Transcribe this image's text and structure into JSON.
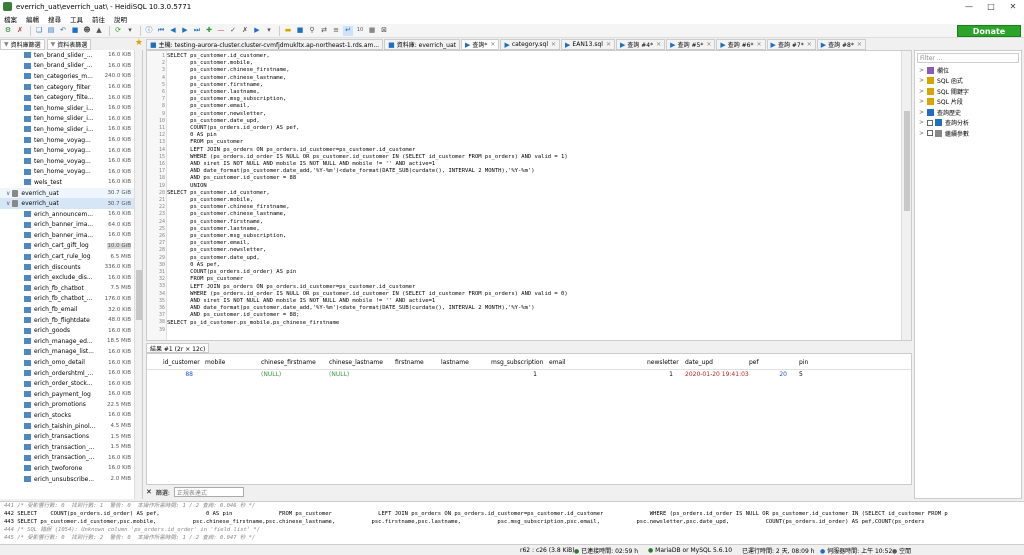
{
  "window": {
    "title": "everrich_uat\\everrich_uat\\ - HeidiSQL 10.3.0.5771"
  },
  "menu": [
    "檔案",
    "編輯",
    "搜尋",
    "工具",
    "前往",
    "說明"
  ],
  "donate_label": "Donate",
  "left_tabs": [
    "資料庫篩選",
    "資料表篩選"
  ],
  "tree": {
    "group1": [
      {
        "name": "ten_brand_slider_...",
        "size": "16.0 KiB"
      },
      {
        "name": "ten_brand_slider_...",
        "size": "16.0 KiB"
      },
      {
        "name": "ten_categories_m...",
        "size": "240.0 KiB"
      },
      {
        "name": "ten_category_filter",
        "size": "16.0 KiB"
      },
      {
        "name": "ten_category_filte...",
        "size": "16.0 KiB"
      },
      {
        "name": "ten_home_slider_i...",
        "size": "16.0 KiB"
      },
      {
        "name": "ten_home_slider_i...",
        "size": "16.0 KiB"
      },
      {
        "name": "ten_home_slider_i...",
        "size": "16.0 KiB"
      },
      {
        "name": "ten_home_voyag...",
        "size": "16.0 KiB"
      },
      {
        "name": "ten_home_voyag...",
        "size": "16.0 KiB"
      },
      {
        "name": "ten_home_voyag...",
        "size": "16.0 KiB"
      },
      {
        "name": "ten_home_voyag...",
        "size": "16.0 KiB"
      },
      {
        "name": "wels_test",
        "size": "16.0 KiB"
      }
    ],
    "db1": {
      "name": "everrich_uat",
      "size": "30.7 GiB"
    },
    "db2": {
      "name": "everrich_uat",
      "size": "30.7 GiB"
    },
    "group2": [
      {
        "name": "erich_announcem...",
        "size": "16.0 KiB"
      },
      {
        "name": "erich_banner_ima...",
        "size": "64.0 KiB"
      },
      {
        "name": "erich_banner_ima...",
        "size": "16.0 KiB"
      },
      {
        "name": "erich_cart_gift_log",
        "size": "10.0 GiB"
      },
      {
        "name": "erich_cart_rule_log",
        "size": "6.5 MiB"
      },
      {
        "name": "erich_discounts",
        "size": "336.0 KiB"
      },
      {
        "name": "erich_exclude_dis...",
        "size": "16.0 KiB"
      },
      {
        "name": "erich_fb_chatbot",
        "size": "7.5 MiB"
      },
      {
        "name": "erich_fb_chatbot_...",
        "size": "176.0 KiB"
      },
      {
        "name": "erich_fb_email",
        "size": "32.0 KiB"
      },
      {
        "name": "erich_fb_flightdate",
        "size": "48.0 KiB"
      },
      {
        "name": "erich_goods",
        "size": "16.0 KiB"
      },
      {
        "name": "erich_manage_ed...",
        "size": "18.5 MiB"
      },
      {
        "name": "erich_manage_list...",
        "size": "16.0 KiB"
      },
      {
        "name": "erich_omo_detail",
        "size": "16.0 KiB"
      },
      {
        "name": "erich_ordershtml_...",
        "size": "16.0 KiB"
      },
      {
        "name": "erich_order_stock...",
        "size": "16.0 KiB"
      },
      {
        "name": "erich_payment_log",
        "size": "16.0 KiB"
      },
      {
        "name": "erich_promotions",
        "size": "22.5 MiB"
      },
      {
        "name": "erich_stocks",
        "size": "16.0 KiB"
      },
      {
        "name": "erich_taishin_pinol...",
        "size": "4.5 MiB"
      },
      {
        "name": "erich_transactions",
        "size": "1.5 MiB"
      },
      {
        "name": "erich_transaction_...",
        "size": "1.5 MiB"
      },
      {
        "name": "erich_transaction_...",
        "size": "16.0 KiB"
      },
      {
        "name": "erich_twoforone",
        "size": "16.0 KiB"
      },
      {
        "name": "erich_unsubscribe...",
        "size": "2.0 MiB"
      }
    ]
  },
  "query_tabs": [
    {
      "label": "主機: testing-aurora-cluster.cluster-cvmfjdmukltx.ap-northeast-1.rds.am...",
      "active": false
    },
    {
      "label": "資料庫: everrich_uat",
      "active": false
    },
    {
      "label": "查詢*",
      "active": true
    },
    {
      "label": "category.sql",
      "active": false
    },
    {
      "label": "EAN13.sql",
      "active": false
    },
    {
      "label": "查詢 #4*",
      "active": false
    },
    {
      "label": "查詢 #5*",
      "active": false
    },
    {
      "label": "查詢 #6*",
      "active": false
    },
    {
      "label": "查詢 #7*",
      "active": false
    },
    {
      "label": "查詢 #8*",
      "active": false
    }
  ],
  "code_lines": [
    "SELECT ps_customer.id_customer,",
    "       ps_customer.mobile,",
    "       ps_customer.chinese_firstname,",
    "       ps_customer.chinese_lastname,",
    "       ps_customer.firstname,",
    "       ps_customer.lastname,",
    "       ps_customer.msg_subscription,",
    "       ps_customer.email,",
    "       ps_customer.newsletter,",
    "       ps_customer.date_upd,",
    "       COUNT(ps_orders.id_order) AS pef,",
    "       0 AS pin",
    "       FROM ps_customer",
    "       LEFT JOIN ps_orders ON ps_orders.id_customer=ps_customer.id_customer",
    "       WHERE (ps_orders.id_order IS NULL OR ps_customer.id_customer IN (SELECT id_customer FROM ps_orders) AND valid = 1)",
    "       AND siret IS NOT NULL AND mobile IS NOT NULL AND mobile != '' AND active=1",
    "       AND date_format(ps_customer.date_add,'%Y-%m')<date_format(DATE_SUB(curdate(), INTERVAL 2 MONTH),'%Y-%m')",
    "       AND ps_customer.id_customer = 88",
    "       UNION",
    "SELECT ps_customer.id_customer,",
    "       ps_customer.mobile,",
    "       ps_customer.chinese_firstname,",
    "       ps_customer.chinese_lastname,",
    "       ps_customer.firstname,",
    "       ps_customer.lastname,",
    "       ps_customer.msg_subscription,",
    "       ps_customer.email,",
    "       ps_customer.newsletter,",
    "       ps_customer.date_upd,",
    "       0 AS pef,",
    "       COUNT(ps_orders.id_order) AS pin",
    "       FROM ps_customer",
    "       LEFT JOIN ps_orders ON ps_orders.id_customer=ps_customer.id_customer",
    "       WHERE (ps_orders.id_order IS NULL OR ps_customer.id_customer IN (SELECT id_customer FROM ps_orders) AND valid = 0)",
    "       AND siret IS NOT NULL AND mobile IS NOT NULL AND mobile != '' AND active=1",
    "       AND date_format(ps_customer.date_add,'%Y-%m')<date_format(DATE_SUB(curdate(), INTERVAL 2 MONTH),'%Y-%m')",
    "       AND ps_customer.id_customer = 88;",
    "",
    "SELECT ps_id_customer.ps_mobile.ps_chinese_firstname"
  ],
  "right_panel": {
    "filter_placeholder": "Filter ...",
    "items": [
      "欄位",
      "SQL 函式",
      "SQL 關鍵字",
      "SQL 片段",
      "查詢歷史",
      "查詢分析",
      "繼續參數"
    ]
  },
  "result_tab": "結果 #1 (2r × 12c)",
  "result_columns": [
    "id_customer",
    "mobile",
    "chinese_firstname",
    "chinese_lastname",
    "firstname",
    "lastname",
    "msg_subscription",
    "email",
    "newsletter",
    "date_upd",
    "pef",
    "pin"
  ],
  "result_row": [
    "88",
    "",
    "(NULL)",
    "(NULL)",
    "",
    "",
    "1",
    "",
    "1",
    "2020-01-20 19:41:03",
    "20",
    "5"
  ],
  "filter_label": "篩選:",
  "filter_placeholder": "正規表達式",
  "log_lines": [
    "441 /* 受影響行數: 0  找到行數: 1  警告: 0  本操作所需時間: 1 / 2 查詢: 0.046 秒 */",
    "442 SELECT    COUNT(ps_orders.id_order) AS pef,              0 AS pin              FROM ps_customer              LEFT JOIN ps_orders ON ps_orders.id_customer=ps_customer.id_customer              WHERE (ps_orders.id_order IS NULL OR ps_customer.id_customer IN (SELECT id_customer FROM p",
    "443 SELECT ps_customer.id_customer,psc.mobile,           psc.chinese_firstname,psc.chinese_lastname,           psc.firstname,psc.lastname,           psc.msg_subscription,psc.email,           psc.newsletter,psc.date_upd,           COUNT(ps_orders.id_order) AS pef,COUNT(ps_orders",
    "444 /* SQL 錯誤 (1054): Unknown column 'ps_orders.id_order' in 'field list' */",
    "445 /* 受影響行數: 0  找到行數: 2  警告: 0  本操作所需時間: 1 / 2 查詢: 0.047 秒 */"
  ],
  "status": {
    "pos": "r62 : c26 (3.8 KiB)",
    "connected": "已連接時間: 02:59 h",
    "server": "MariaDB or MySQL 5.6.10",
    "uptime": "已運行時間: 2 天, 08:09 h",
    "server_time": "伺服器時間: 上午 10:52",
    "idle": "空閒"
  }
}
